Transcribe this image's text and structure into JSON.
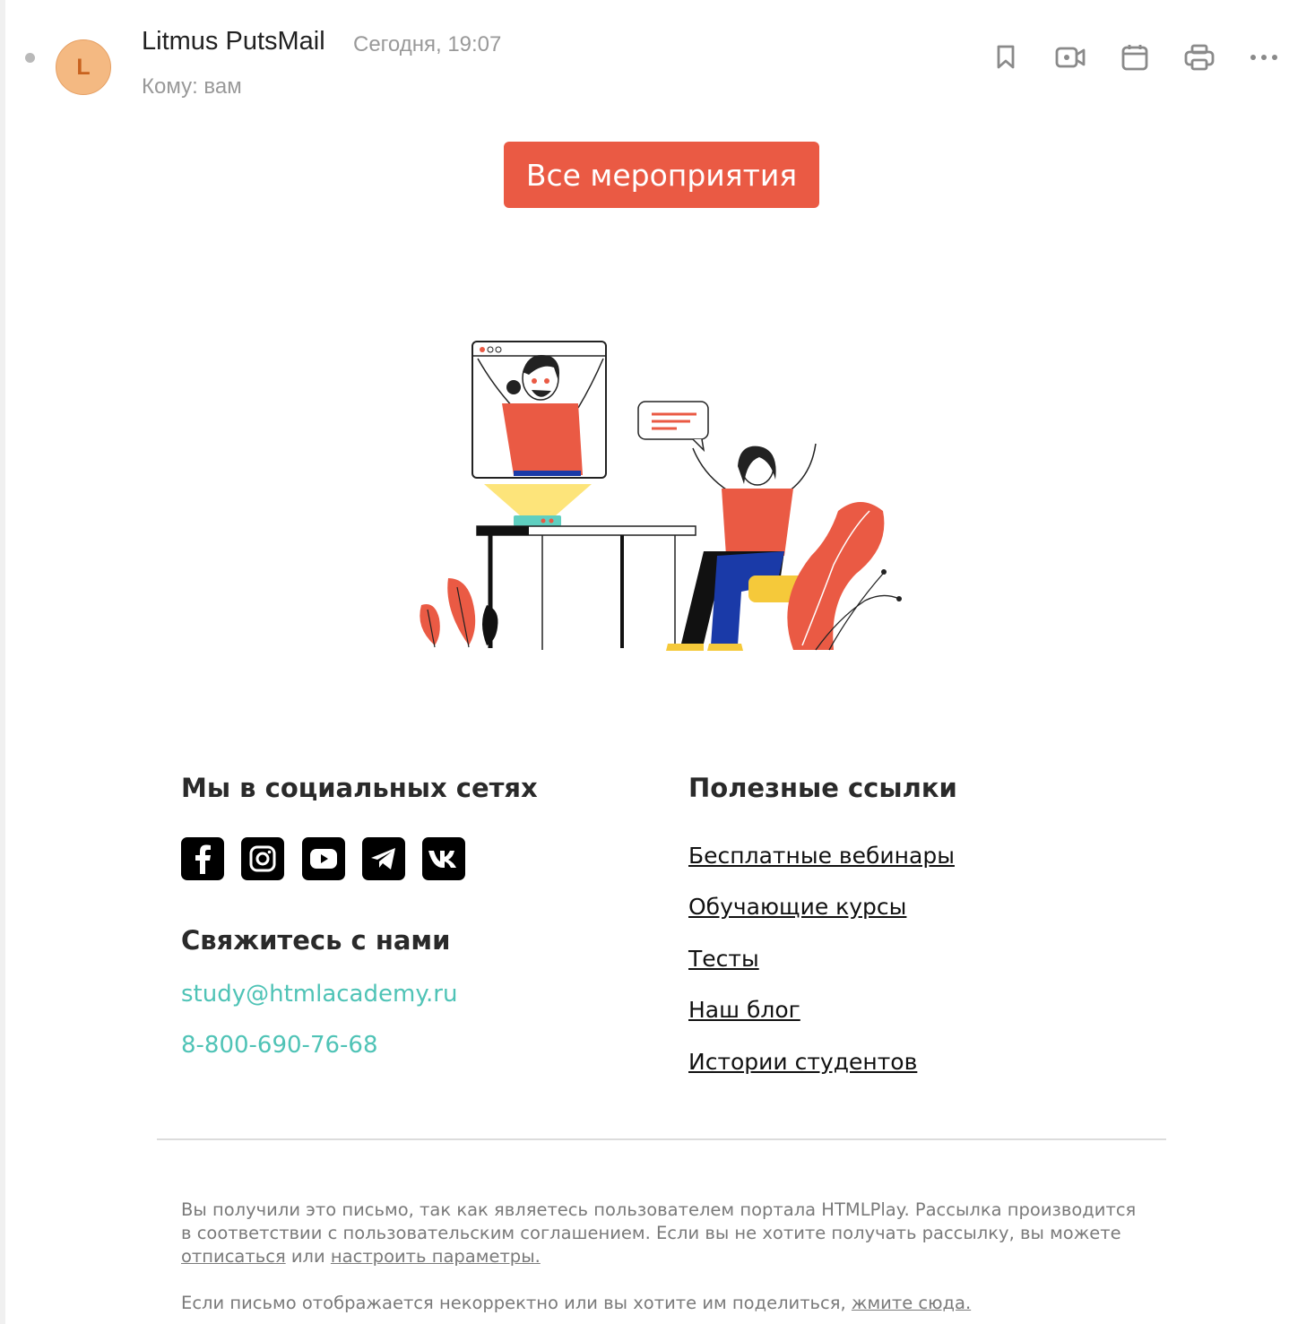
{
  "header": {
    "avatar_letter": "L",
    "sender": "Litmus PutsMail",
    "date": "Сегодня, 19:07",
    "recipient": "Кому: вам"
  },
  "toolbar": {
    "icons": [
      "bookmark-icon",
      "video-call-icon",
      "calendar-icon",
      "print-icon",
      "more-icon"
    ]
  },
  "cta": {
    "label": "Все мероприятия",
    "color": "#ea5a44"
  },
  "social": {
    "heading": "Мы в социальных сетях",
    "icons": [
      "facebook-icon",
      "instagram-icon",
      "youtube-icon",
      "telegram-icon",
      "vk-icon"
    ]
  },
  "contact": {
    "heading": "Свяжитесь с нами",
    "email": "study@htmlacademy.ru",
    "phone": "8-800-690-76-68",
    "color": "#4fc3b6"
  },
  "links": {
    "heading": "Полезные ссылки",
    "items": [
      "Бесплатные вебинары",
      "Обучающие курсы",
      "Тесты",
      "Наш блог",
      "Истории студентов"
    ]
  },
  "footer": {
    "notice_text": "Вы получили это письмо, так как являетесь пользователем портала HTMLPlay. Рассылка производится в соответствии с пользовательским соглашением. Если вы не хотите получать рассылку, вы можете ",
    "unsubscribe": "отписаться",
    "or": " или ",
    "settings": "настроить параметры.",
    "share_text": "Если письмо отображается некорректно или вы хотите им поделиться, ",
    "share_link": "жмите сюда."
  }
}
